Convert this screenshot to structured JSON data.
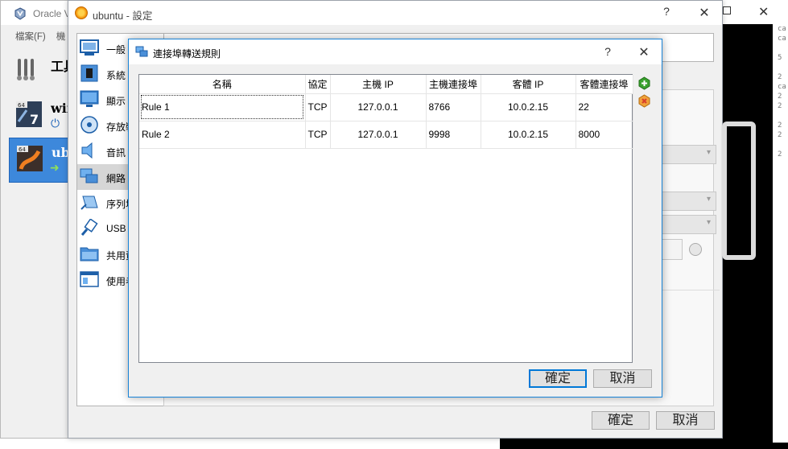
{
  "manager": {
    "title": "Oracle V",
    "menu": [
      "檔案(F)",
      "機"
    ],
    "vms": [
      {
        "name": "工具",
        "kind": "tools"
      },
      {
        "name": "win",
        "kind": "windows"
      },
      {
        "name": "ubuntu",
        "kind": "ubuntu"
      }
    ]
  },
  "console": {
    "side_text": [
      "ca",
      "ca",
      "",
      "5",
      "",
      "2",
      "ca",
      "2",
      "2",
      "",
      "2",
      "2",
      "",
      "2"
    ]
  },
  "settings": {
    "title": "ubuntu - 設定",
    "help": "?",
    "close": "✕",
    "sidebar": [
      {
        "label": "一般",
        "icon": "general-icon"
      },
      {
        "label": "系統",
        "icon": "system-chip-icon"
      },
      {
        "label": "顯示",
        "icon": "display-monitor-icon"
      },
      {
        "label": "存放裝",
        "icon": "storage-disk-icon"
      },
      {
        "label": "音訊",
        "icon": "audio-speaker-icon"
      },
      {
        "label": "網路",
        "icon": "network-icon"
      },
      {
        "label": "序列埠",
        "icon": "serial-port-icon"
      },
      {
        "label": "USB",
        "icon": "usb-icon"
      },
      {
        "label": "共用資",
        "icon": "shared-folder-icon"
      },
      {
        "label": "使用者",
        "icon": "user-interface-icon"
      }
    ],
    "ok_label": "確定",
    "cancel_label": "取消"
  },
  "port_forwarding": {
    "title": "連接埠轉送規則",
    "help": "?",
    "close": "✕",
    "columns": [
      "名稱",
      "協定",
      "主機 IP",
      "主機連接埠",
      "客體 IP",
      "客體連接埠"
    ],
    "rows": [
      [
        "Rule 1",
        "TCP",
        "127.0.0.1",
        "8766",
        "10.0.2.15",
        "22"
      ],
      [
        "Rule 2",
        "TCP",
        "127.0.0.1",
        "9998",
        "10.0.2.15",
        "8000"
      ]
    ],
    "ok_label": "確定",
    "cancel_label": "取消",
    "colors": {
      "accent": "#0078d7",
      "add": "#3aa12e",
      "remove": "#d9412c"
    }
  }
}
